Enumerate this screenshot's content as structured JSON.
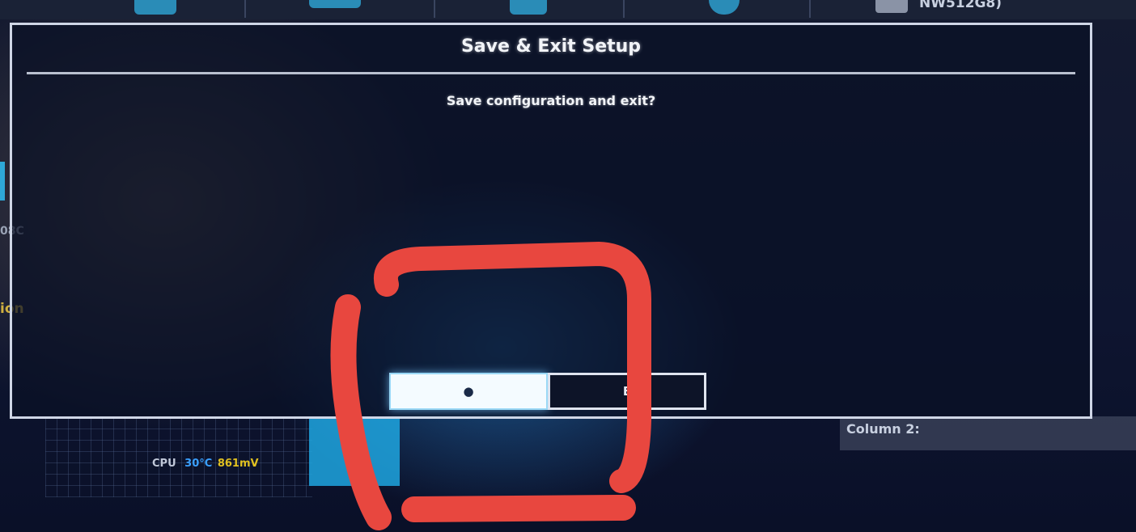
{
  "background": {
    "drive_label": "NW512G8)",
    "left_fragments": [
      "08C",
      "ion"
    ],
    "cpu_readout": {
      "label": "CPU",
      "temp": "30°C",
      "voltage": "861mV"
    },
    "column_label": "Column 2:"
  },
  "dialog": {
    "title": "Save & Exit Setup",
    "message": "Save configuration and exit?",
    "buttons": {
      "yes_label": "●",
      "no_label": "E"
    }
  },
  "annotation": {
    "color": "#e8473f",
    "shape": "hand-drawn rectangle around dialog buttons"
  },
  "colors": {
    "accent": "#2ea8d8",
    "dialog_border": "#cfd6e6",
    "annotation": "#e8473f"
  }
}
